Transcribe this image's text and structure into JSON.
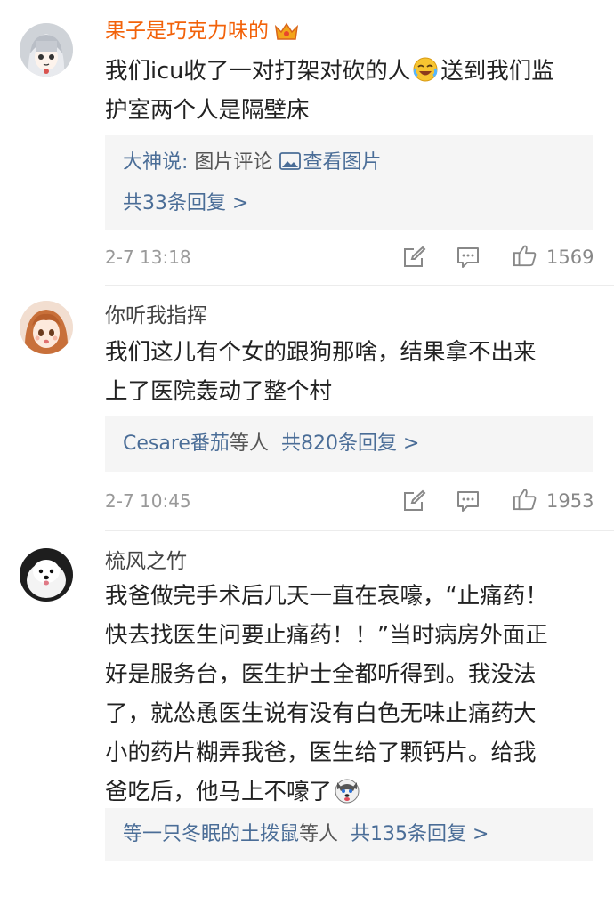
{
  "comments": [
    {
      "username": "果子是巧克力味的",
      "user_style": "vip",
      "avatar": "anime-girl-gray-hair-avatar",
      "crown_icon": "vip-crown-icon",
      "lines": [
        "我们icu收了一对打架对砍的人",
        "送到我们监",
        "护室两个人是隔壁床"
      ],
      "emoji": "laughing-crying-emoji",
      "reply": {
        "author": "大神说:",
        "text": "图片评论",
        "view_pic": "查看图片",
        "count_text": "共33条回复 >"
      },
      "time": "2-7 13:18",
      "likes": "1569"
    },
    {
      "username": "你听我指挥",
      "user_style": "normal",
      "avatar": "anime-girl-orange-hair-avatar",
      "lines": [
        "我们这儿有个女的跟狗那啥，结果拿不出来",
        "上了医院轰动了整个村"
      ],
      "reply": {
        "users": "Cesare番茄",
        "suffix": "等人",
        "count_text": "共820条回复 >"
      },
      "time": "2-7 10:45",
      "likes": "1953"
    },
    {
      "username": "梳风之竹",
      "user_style": "normal",
      "avatar": "white-dog-avatar",
      "lines": [
        "我爸做完手术后几天一直在哀嚎，“止痛药！",
        "快去找医生问要止痛药！！”当时病房外面正",
        "好是服务台，医生护士全都听得到。我没法",
        "了，就怂恿医生说有没有白色无味止痛药大",
        "小的药片糊弄我爸，医生给了颗钙片。给我",
        "爸吃后，他马上不嚎了"
      ],
      "emoji": "husky-dog-emoji",
      "reply": {
        "users": "等一只冬眠的土拨鼠",
        "suffix": "等人",
        "count_text": "共135条回复 >"
      }
    }
  ],
  "icons": {
    "share": "share-edit-icon",
    "comment": "comment-bubble-icon",
    "like": "thumbs-up-icon",
    "picture": "picture-icon"
  },
  "colors": {
    "vip_name": "#f2620a",
    "link_blue": "#4a6d97",
    "reply_bg": "#f5f5f5",
    "meta_gray": "#999999"
  }
}
